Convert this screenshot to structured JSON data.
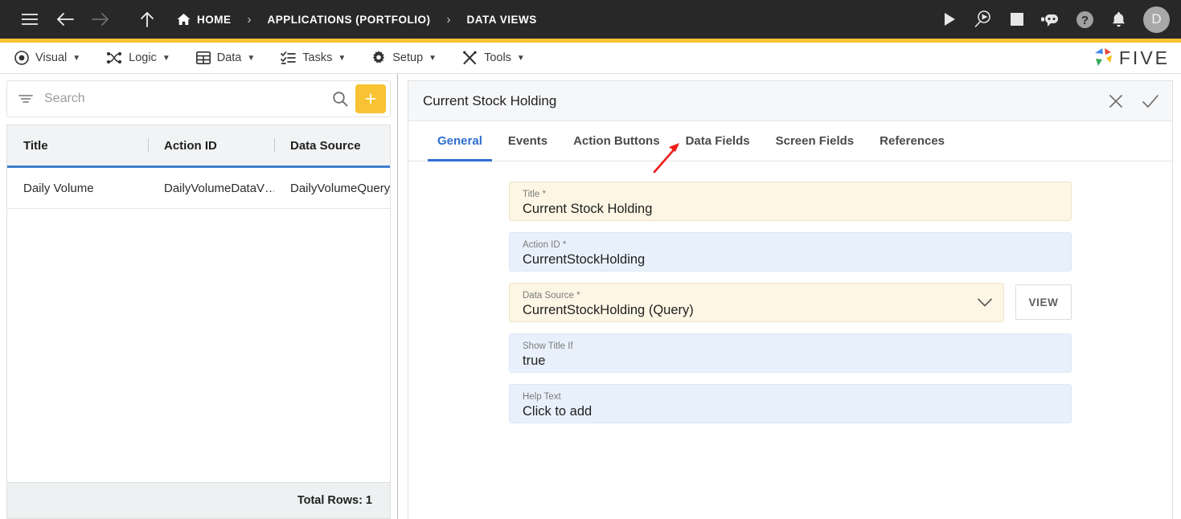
{
  "topbar": {
    "menu_icon": "hamburger-icon",
    "back_icon": "arrow-left-icon",
    "forward_icon": "arrow-right-icon",
    "up_icon": "arrow-up-icon",
    "breadcrumbs": [
      {
        "label": "HOME",
        "icon": "home-icon"
      },
      {
        "label": "APPLICATIONS (PORTFOLIO)",
        "icon": ""
      },
      {
        "label": "DATA VIEWS",
        "icon": ""
      }
    ],
    "separator": "›",
    "actions": [
      {
        "name": "run-icon",
        "title": "Run"
      },
      {
        "name": "debug-icon",
        "title": "Debug"
      },
      {
        "name": "stop-icon",
        "title": "Stop"
      },
      {
        "name": "chatbot-icon",
        "title": "Assistant"
      },
      {
        "name": "help-icon",
        "title": "Help"
      },
      {
        "name": "notification-bell-icon",
        "title": "Notifications"
      }
    ],
    "avatar_initial": "D",
    "accent_color": "#F9C232",
    "background_color": "#282828"
  },
  "menubar": {
    "items": [
      {
        "label": "Visual",
        "icon": "eye-icon",
        "caret": "▼"
      },
      {
        "label": "Logic",
        "icon": "nodes-icon",
        "caret": "▼"
      },
      {
        "label": "Data",
        "icon": "table-icon",
        "caret": "▼"
      },
      {
        "label": "Tasks",
        "icon": "checklist-icon",
        "caret": "▼"
      },
      {
        "label": "Setup",
        "icon": "gear-icon",
        "caret": "▼"
      },
      {
        "label": "Tools",
        "icon": "tools-icon",
        "caret": "▼"
      }
    ],
    "logo_text": "FIVE"
  },
  "left_panel": {
    "search": {
      "placeholder": "Search",
      "value": "",
      "filter_icon": "filter-icon",
      "search_icon": "search-icon"
    },
    "add_button_label": "+",
    "table": {
      "columns": [
        "Title",
        "Action ID",
        "Data Source"
      ],
      "rows": [
        {
          "title": "Daily Volume",
          "action_id": "DailyVolumeDataV…",
          "data_source": "DailyVolumeQuery …"
        }
      ],
      "footer": "Total Rows: 1"
    }
  },
  "right_panel": {
    "title": "Current Stock Holding",
    "close_icon": "close-icon",
    "confirm_icon": "check-icon",
    "tabs": [
      {
        "label": "General",
        "active": true
      },
      {
        "label": "Events",
        "active": false
      },
      {
        "label": "Action Buttons",
        "active": false
      },
      {
        "label": "Data Fields",
        "active": false
      },
      {
        "label": "Screen Fields",
        "active": false
      },
      {
        "label": "References",
        "active": false
      }
    ],
    "annotation": {
      "type": "arrow",
      "color": "#ee1c17",
      "points_to": "Data Fields"
    },
    "fields": [
      {
        "label": "Title *",
        "value": "Current Stock Holding",
        "style": "cream",
        "dropdown": false
      },
      {
        "label": "Action ID *",
        "value": "CurrentStockHolding",
        "style": "blue",
        "dropdown": false
      },
      {
        "label": "Data Source *",
        "value": "CurrentStockHolding (Query)",
        "style": "cream",
        "dropdown": true
      },
      {
        "label": "Show Title If",
        "value": "true",
        "style": "blue",
        "dropdown": false
      },
      {
        "label": "Help Text",
        "value": "Click to add",
        "style": "blue",
        "dropdown": false
      }
    ],
    "view_button_label": "VIEW"
  }
}
